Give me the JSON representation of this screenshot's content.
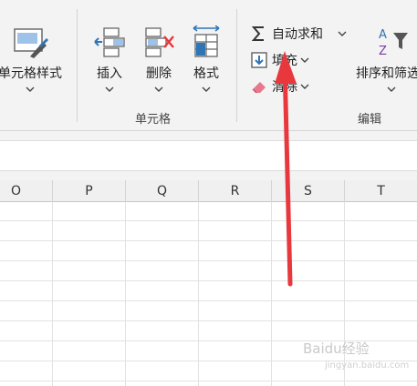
{
  "ribbon": {
    "styles": {
      "cell_style_label": "单元格样式"
    },
    "cells_group": {
      "insert_label": "插入",
      "delete_label": "删除",
      "format_label": "格式",
      "group_label": "单元格"
    },
    "editing_group": {
      "autosum_label": "自动求和",
      "fill_label": "填充",
      "clear_label": "清除",
      "sort_filter_label": "排序和筛选",
      "group_label": "编辑"
    }
  },
  "sheet": {
    "columns": [
      "O",
      "P",
      "Q",
      "R",
      "S",
      "T"
    ]
  },
  "watermark": {
    "text": "Baidu经验",
    "sub": "jingyan.baidu.com"
  },
  "colors": {
    "accent_red": "#e8383d",
    "ribbon_bg": "#f3f3f3",
    "blue_icon": "#2e75b6"
  }
}
